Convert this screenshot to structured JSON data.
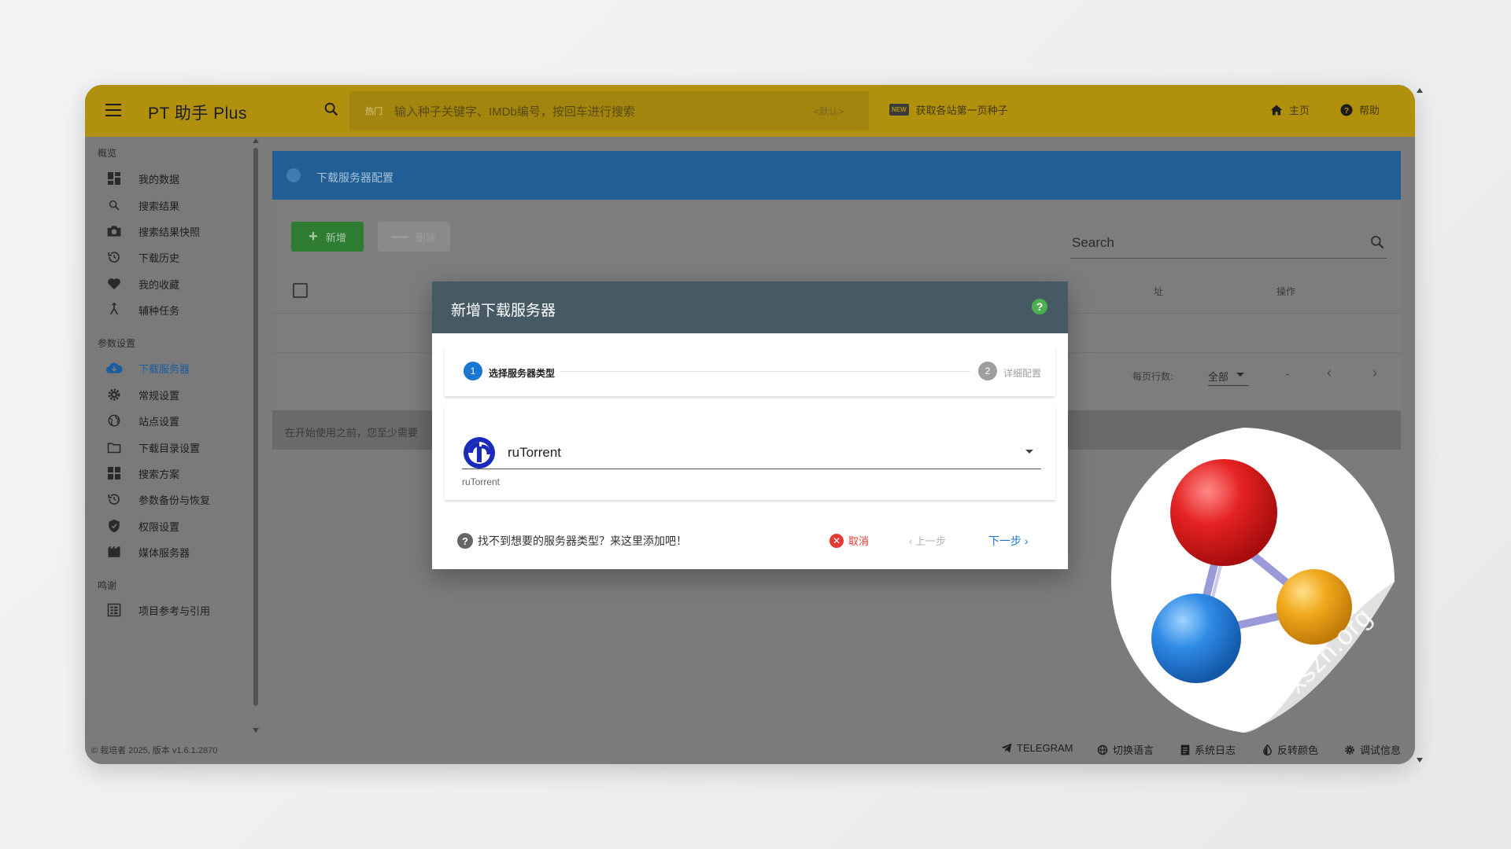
{
  "appbar": {
    "title": "PT 助手 Plus",
    "search_hot_tag": "热门",
    "search_placeholder": "输入种子关键字、IMDb编号，按回车进行搜索",
    "search_default": "<默认>",
    "new_badge": "NEW",
    "fetch_label": "获取各站第一页种子",
    "home_label": "主页",
    "help_label": "帮助"
  },
  "sidebar": {
    "sections": [
      {
        "header": "概览"
      },
      {
        "header": "参数设置"
      },
      {
        "header": "鸣谢"
      }
    ],
    "items": [
      {
        "label": "我的数据",
        "icon": "dashboard-icon"
      },
      {
        "label": "搜索结果",
        "icon": "search-icon"
      },
      {
        "label": "搜索结果快照",
        "icon": "camera-icon"
      },
      {
        "label": "下载历史",
        "icon": "history-icon"
      },
      {
        "label": "我的收藏",
        "icon": "heart-icon"
      },
      {
        "label": "辅种任务",
        "icon": "fork-icon"
      },
      {
        "label": "下载服务器",
        "icon": "cloud-download-icon",
        "active": true
      },
      {
        "label": "常规设置",
        "icon": "gear-icon"
      },
      {
        "label": "站点设置",
        "icon": "globe-icon"
      },
      {
        "label": "下载目录设置",
        "icon": "folder-icon"
      },
      {
        "label": "搜索方案",
        "icon": "grid-icon"
      },
      {
        "label": "参数备份与恢复",
        "icon": "restore-icon"
      },
      {
        "label": "权限设置",
        "icon": "shield-icon"
      },
      {
        "label": "媒体服务器",
        "icon": "film-icon"
      },
      {
        "label": "项目参考与引用",
        "icon": "reference-icon"
      }
    ]
  },
  "main": {
    "info_title": "下载服务器配置",
    "add_label": "新增",
    "delete_label": "删除",
    "search_placeholder": "Search",
    "col_url": "址",
    "col_actions": "操作",
    "rows_label": "每页行数:",
    "rows_value": "全部",
    "range_label": "-",
    "note": "在开始使用之前，您至少需要"
  },
  "footer": {
    "copyright": "© 栽培者 2025, 版本 v1.6.1.2870",
    "telegram": "TELEGRAM",
    "language": "切换语言",
    "syslog": "系统日志",
    "invert": "反转颜色",
    "debug": "调试信息"
  },
  "modal": {
    "title": "新增下载服务器",
    "help": "?",
    "step1_num": "1",
    "step1_label": "选择服务器类型",
    "step2_num": "2",
    "step2_label": "详细配置",
    "selected": "ruTorrent",
    "selected_hint": "ruTorrent",
    "foot_help": "找不到想要的服务器类型？来这里添加吧！",
    "cancel": "取消",
    "prev": "上一步",
    "next": "下一步"
  },
  "watermark": "xszn.org",
  "colors": {
    "appbar": "#b1900d",
    "info_bar": "#215e96",
    "add_button": "#2e7d32",
    "modal_header": "#455a64",
    "accent_blue": "#1976d2",
    "cancel_red": "#e53935"
  }
}
